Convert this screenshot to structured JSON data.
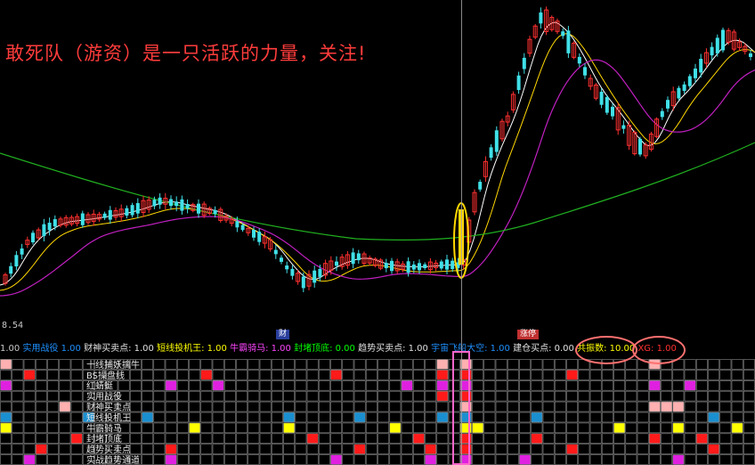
{
  "headline": "敢死队（游资）是一只活跃的力量，关注!",
  "price_min": "8.54",
  "markers": {
    "blue": "财",
    "red": "涨停"
  },
  "signal_bar": [
    {
      "text": "1.00 ",
      "color": "#c8c8c8"
    },
    {
      "text": "实用战役 ",
      "color": "#1e90ff"
    },
    {
      "text": "1.00 ",
      "color": "#1e90ff"
    },
    {
      "text": "财神买卖点: 1.00 ",
      "color": "#e0e0e0"
    },
    {
      "text": "短线投机王: 1.00 ",
      "color": "#ffff00"
    },
    {
      "text": "牛霸骑马: 1.00 ",
      "color": "#ff44ff"
    },
    {
      "text": "封堵顶底: 0.00 ",
      "color": "#00ff00"
    },
    {
      "text": "趋势买卖点: 1.00 ",
      "color": "#e0e0e0"
    },
    {
      "text": "宇宙飞船大空: 1.00 ",
      "color": "#1e90ff"
    },
    {
      "text": "建仓买点: 0.00 ",
      "color": "#e0e0e0"
    },
    {
      "text": "共振数: 10.00 ",
      "color": "#ffff00"
    },
    {
      "text": "XG: 1.00",
      "color": "#ff3030"
    }
  ],
  "indicator_rows": [
    {
      "label": "十线捕妖擒牛",
      "color": "#ffb0b0"
    },
    {
      "label": "BS操盘线",
      "color": "#ff1a1a"
    },
    {
      "label": "红蜻蜓",
      "color": "#e020e0"
    },
    {
      "label": "实用战役",
      "color": "#ff1a1a"
    },
    {
      "label": "财神买卖点",
      "color": "#ffb0b0"
    },
    {
      "label": "短线投机王",
      "color": "#1a8fd0"
    },
    {
      "label": "牛霸骑马",
      "color": "#ffff00"
    },
    {
      "label": "封堵顶底",
      "color": "#ff1a1a"
    },
    {
      "label": "趋势买卖点",
      "color": "#ff1a1a"
    },
    {
      "label": "实战趋势通道",
      "color": "#e020e0"
    }
  ],
  "colors": {
    "up": "#ff3030",
    "down": "#40e0e8",
    "ma_white": "#ffffff",
    "ma_yellow": "#ffd700",
    "ma_purple": "#c020c0",
    "ma_green": "#20b020",
    "grid_line": "#8a8a8a"
  }
}
